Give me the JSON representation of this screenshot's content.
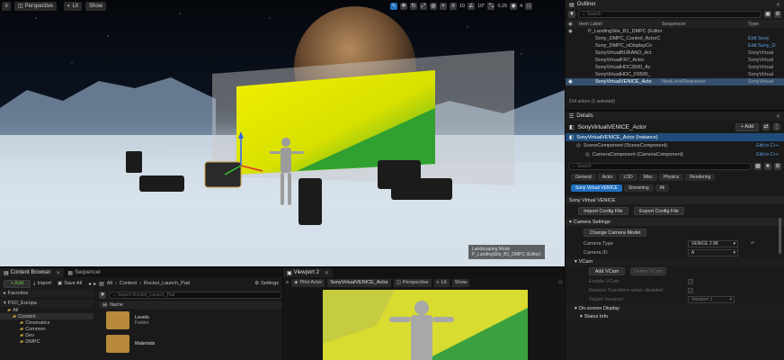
{
  "viewport": {
    "perspective_label": "Perspective",
    "lit_label": "Lit",
    "show_label": "Show",
    "snap_grid": "10",
    "snap_angle": "10°",
    "snap_scale": "0.25",
    "camera_speed": "4",
    "overlay_line1": "Landscaping Mode",
    "overlay_line2": "P_LandingSite_B1_DMPC (Editor)"
  },
  "outliner": {
    "tab_label": "Outliner",
    "search_placeholder": "Search",
    "col_item": "Item Label",
    "col_sequencer": "Sequencer",
    "col_type": "Type",
    "rows": [
      {
        "label": "P_LandingSite_B1_DMPC (Editor)",
        "seq": "",
        "type": ""
      },
      {
        "label": "Sony_DMPC_Control_ActorC",
        "seq": "",
        "type": "Edit Sony"
      },
      {
        "label": "Sony_DMPC_nDisplayCo",
        "seq": "",
        "type": "Edit Sony_D"
      },
      {
        "label": "SonyVirtualBURANO_Act",
        "seq": "",
        "type": "SonyVirtual"
      },
      {
        "label": "SonyVirtualFR7_Actor",
        "seq": "",
        "type": "SonyVirtual"
      },
      {
        "label": "SonyVirtualHDC3500_Ac",
        "seq": "",
        "type": "SonyVirtual"
      },
      {
        "label": "SonyVirtualHDC_F5500_",
        "seq": "",
        "type": "SonyVirtual"
      },
      {
        "label": "SonyVirtualVENICE_Acto",
        "seq": "NewLevelSequence",
        "type": "SonyVirtual"
      }
    ],
    "status": "514 actors (1 selected)"
  },
  "details": {
    "tab_label": "Details",
    "actor_name": "SonyVirtualVENICE_Actor",
    "add_label": "+ Add",
    "instance_label": "SonyVirtualVENICE_Actor (Instance)",
    "components": [
      {
        "label": "SceneComponent (SceneComponent)",
        "link": "Edit in C++"
      },
      {
        "label": "CameraComponent (CameraComponent)",
        "link": "Edit in C++"
      }
    ],
    "search_placeholder": "Search",
    "filter_tabs_1": [
      "General",
      "Actor",
      "LOD",
      "Misc",
      "Physics",
      "Rendering"
    ],
    "filter_tabs_2": [
      "Sony Virtual VENICE",
      "Streaming",
      "All"
    ],
    "section_venice": "Sony Virtual VENICE",
    "import_btn": "Import Config File",
    "export_btn": "Export Config File",
    "section_camera": "Camera Settings",
    "change_model_btn": "Change Camera Model",
    "camera_type_label": "Camera Type",
    "camera_type_value": "VENICE 2 8K",
    "camera_id_label": "Camera ID",
    "camera_id_value": "A",
    "section_vcam": "VCam",
    "add_vcam_btn": "Add VCam",
    "delete_vcam_btn": "Delete VCam",
    "enable_vcam_label": "Enable VCam",
    "restore_label": "Restore Transform when disabled",
    "target_viewport_label": "Target Viewport",
    "target_viewport_value": "Viewport 1",
    "onscreen_label": "On-screen Display",
    "status_info_label": "Status Info"
  },
  "content_browser": {
    "tab1": "Content Browser",
    "tab2": "Sequencer",
    "add_label": "+ Add",
    "import_label": "Import",
    "saveall_label": "Save All",
    "path": [
      "All",
      "Content",
      "Rocket_Launch_Pad"
    ],
    "settings_label": "Settings",
    "favorites_label": "Favorites",
    "project_label": "PXD_Europa",
    "search_placeholder": "Search Rocket_Launch_Pad",
    "name_col": "Name",
    "tree": [
      "All",
      "Content",
      "Cinematics",
      "Common",
      "Dev",
      "DMPC"
    ],
    "folders": [
      {
        "name": "Levels",
        "kind": "Folder"
      },
      {
        "name": "Materials",
        "kind": ""
      }
    ]
  },
  "viewport2": {
    "tab": "Viewport 2",
    "pilot_label": "Pilot Actor",
    "pilot_name": "SonyVirtualVENICE_Actor",
    "perspective_label": "Perspective",
    "lit_label": "Lit",
    "show_label": "Show"
  }
}
